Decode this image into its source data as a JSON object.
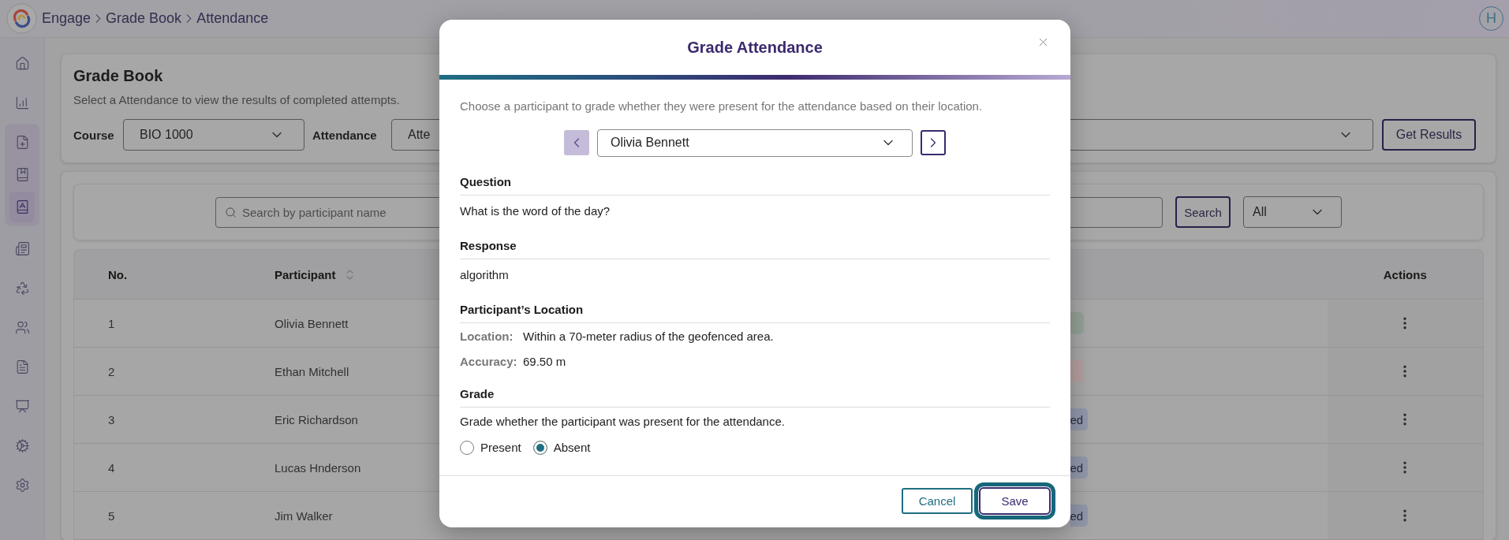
{
  "header": {
    "breadcrumbs": [
      "Engage",
      "Grade Book",
      "Attendance"
    ],
    "avatar": "H"
  },
  "sidebar": {
    "items": [
      {
        "selected": false
      },
      {
        "selected": false
      },
      {
        "selected": false,
        "expanded": true,
        "children": [
          {
            "selected": false
          },
          {
            "selected": true
          }
        ]
      },
      {
        "selected": false
      },
      {
        "selected": false
      },
      {
        "selected": false
      },
      {
        "selected": false
      },
      {
        "selected": false
      },
      {
        "selected": false
      },
      {
        "selected": false
      }
    ]
  },
  "filter_card": {
    "title": "Grade Book",
    "subtitle": "Select a Attendance to view the results of completed attempts.",
    "filters": [
      {
        "label": "Course",
        "value": "BIO 1000"
      },
      {
        "label": "Attendance",
        "value": "Atte"
      }
    ],
    "button": "Get Results"
  },
  "search_bar": {
    "placeholder": "Search by participant name",
    "button": "Search",
    "filter": "All"
  },
  "table": {
    "columns": [
      {
        "label": "No.",
        "sortable": false
      },
      {
        "label": "Participant",
        "sortable": true
      },
      {
        "label": "Actions",
        "sortable": false
      }
    ],
    "rows": [
      {
        "no": "1",
        "participant": "Olivia Bennett",
        "status": {
          "color": "#93a096"
        }
      },
      {
        "no": "2",
        "participant": "Ethan Mitchell",
        "status": {
          "color": "#b39e9f"
        }
      },
      {
        "no": "3",
        "participant": "Eric Richardson",
        "status": {
          "text": "ed",
          "color": "#9097aa"
        }
      },
      {
        "no": "4",
        "participant": "Lucas Hnderson",
        "status": {
          "text": "ed",
          "color": "#9097aa"
        }
      },
      {
        "no": "5",
        "participant": "Jim Walker",
        "status": {
          "text": "ed",
          "color": "#9097aa"
        }
      }
    ]
  },
  "dialog": {
    "title": "Grade Attendance",
    "description": "Choose a participant to grade whether they were present for the attendance based on their location.",
    "participant": {
      "value": "Olivia Bennett",
      "previous_disabled": true,
      "next_disabled": false
    },
    "sections": [
      {
        "kind": "text",
        "heading": "Question",
        "text": "What is the word of the day?"
      },
      {
        "kind": "text",
        "heading": "Response",
        "text": "algorithm"
      },
      {
        "kind": "fields",
        "heading": "Participant’s Location",
        "fields": [
          {
            "label": "Location:",
            "value": "Within a 70-meter radius of the geofenced area."
          },
          {
            "label": "Accuracy:",
            "value": "69.50 m"
          }
        ]
      },
      {
        "kind": "choice",
        "heading": "Grade",
        "text": "Grade whether the participant was present for the attendance.",
        "options": [
          {
            "label": "Present",
            "selected": false
          },
          {
            "label": "Absent",
            "selected": true
          }
        ]
      }
    ],
    "buttons": [
      {
        "label": "Cancel",
        "kind": "secondary",
        "focused": false
      },
      {
        "label": "Save",
        "kind": "primary",
        "focused": true
      }
    ]
  }
}
